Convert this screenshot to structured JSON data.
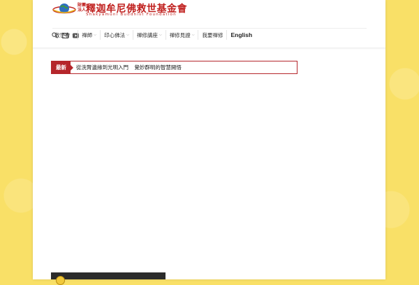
{
  "header": {
    "logo_small_text": "財團法人",
    "logo_title": "釋迦牟尼佛救世基金會",
    "logo_subtitle": "Shakyamuni Buddhist Foundation"
  },
  "icons": [
    "search-icon",
    "mail-icon",
    "youtube-icon"
  ],
  "nav": {
    "items": [
      {
        "label": "救世會",
        "has_dropdown": true
      },
      {
        "label": "禪師",
        "has_dropdown": true
      },
      {
        "label": "印心佛法",
        "has_dropdown": true
      },
      {
        "label": "禪修講座",
        "has_dropdown": true
      },
      {
        "label": "禪修見證",
        "has_dropdown": true
      },
      {
        "label": "我要禪修",
        "has_dropdown": false
      },
      {
        "label": "English",
        "has_dropdown": false
      }
    ]
  },
  "ticker": {
    "label": "最新",
    "text": "從洗腎邊緣到光明入門 覺妙群明的智慧開悟"
  },
  "colors": {
    "background": "#f9e067",
    "brand_red": "#b5262b",
    "logo_red": "#c0201e"
  }
}
